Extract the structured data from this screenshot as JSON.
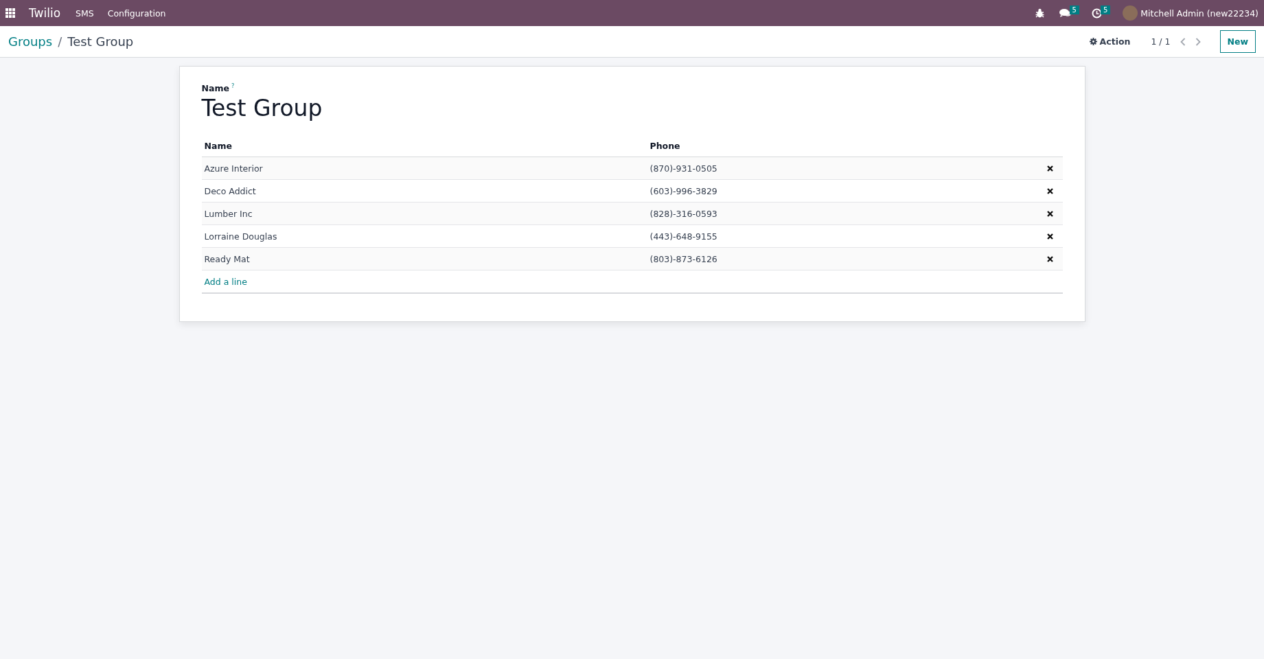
{
  "navbar": {
    "app_name": "Twilio",
    "menus": [
      "SMS",
      "Configuration"
    ],
    "messages_count": "5",
    "activities_count": "5",
    "user": "Mitchell Admin (new22234)"
  },
  "control_panel": {
    "breadcrumbs": [
      "Groups",
      "Test Group"
    ],
    "breadcrumb_separator": "/",
    "action": "Action",
    "pager": "1 / 1",
    "new_button": "New"
  },
  "form": {
    "field_label": "Name",
    "help_mark": "?",
    "name": "Test Group",
    "table": {
      "columns": [
        "Name",
        "Phone"
      ],
      "rows": [
        {
          "name": "Azure Interior",
          "phone": "(870)-931-0505"
        },
        {
          "name": "Deco Addict",
          "phone": "(603)-996-3829"
        },
        {
          "name": "Lumber Inc",
          "phone": "(828)-316-0593"
        },
        {
          "name": "Lorraine Douglas",
          "phone": "(443)-648-9155"
        },
        {
          "name": "Ready Mat",
          "phone": "(803)-873-6126"
        }
      ],
      "add_line": "Add a line"
    }
  }
}
